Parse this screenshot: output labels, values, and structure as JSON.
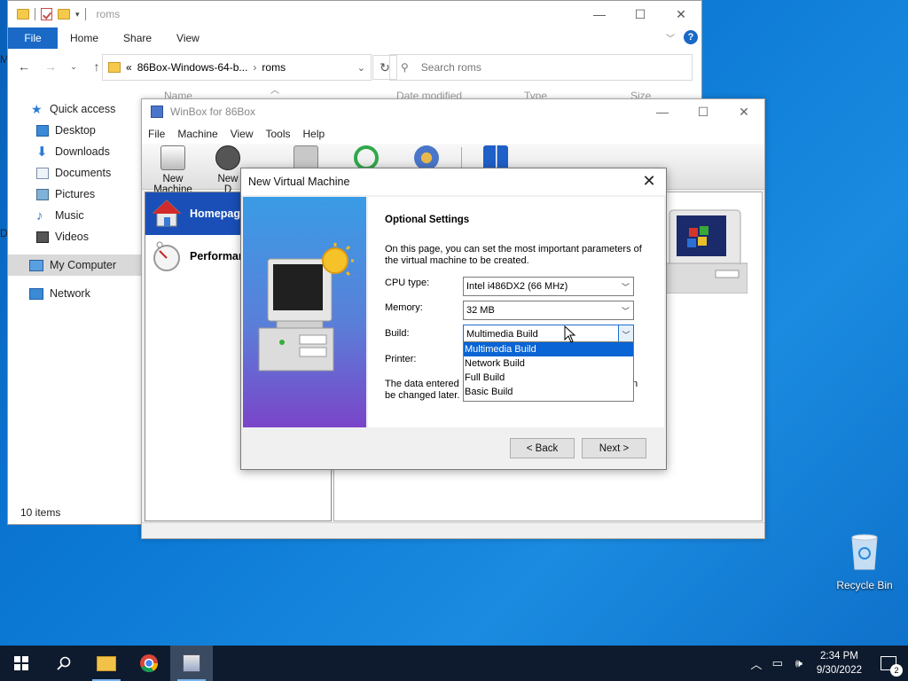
{
  "explorer": {
    "title": "roms",
    "ribbon_tabs": [
      "File",
      "Home",
      "Share",
      "View"
    ],
    "address": {
      "prefix": "«",
      "crumbs": [
        "86Box-Windows-64-b...",
        "roms"
      ]
    },
    "search_placeholder": "Search roms",
    "columns": [
      "Name",
      "Date modified",
      "Type",
      "Size"
    ],
    "nav": [
      {
        "label": "Quick access",
        "icon": "star-icon"
      },
      {
        "label": "Desktop",
        "icon": "desktop-icon"
      },
      {
        "label": "Downloads",
        "icon": "download-icon"
      },
      {
        "label": "Documents",
        "icon": "documents-icon"
      },
      {
        "label": "Pictures",
        "icon": "pictures-icon"
      },
      {
        "label": "Music",
        "icon": "music-icon"
      },
      {
        "label": "Videos",
        "icon": "videos-icon"
      },
      {
        "label": "My Computer",
        "icon": "computer-icon"
      },
      {
        "label": "Network",
        "icon": "network-icon"
      }
    ],
    "status": "10 items"
  },
  "winbox": {
    "title": "WinBox for 86Box",
    "menu": [
      "File",
      "Machine",
      "View",
      "Tools",
      "Help"
    ],
    "tools": [
      {
        "label": "New Machine"
      },
      {
        "label": "New D"
      }
    ],
    "list": [
      {
        "label": "Homepage",
        "selected": true
      },
      {
        "label": "Performan",
        "selected": false
      }
    ]
  },
  "dialog": {
    "title": "New Virtual Machine",
    "heading": "Optional Settings",
    "description": "On this page, you can set the most important parameters of the virtual machine to be created.",
    "fields": {
      "cpu_label": "CPU type:",
      "cpu_value": "Intel i486DX2 (66 MHz)",
      "memory_label": "Memory:",
      "memory_value": "32 MB",
      "build_label": "Build:",
      "build_value": "Multimedia Build",
      "printer_label": "Printer:"
    },
    "build_options": [
      "Multimedia Build",
      "Network Build",
      "Full Build",
      "Basic Build"
    ],
    "note_start": "The data entered",
    "note_mid": "n",
    "note_end": "be changed later.",
    "back_label": "< Back",
    "next_label": "Next >"
  },
  "desktop": {
    "recycle_bin": "Recycle Bin"
  },
  "taskbar": {
    "time": "2:34 PM",
    "date": "9/30/2022",
    "notification_count": "2"
  },
  "colors": {
    "selection": "#0a64d4",
    "ribbon_file": "#1a69c7",
    "taskbar": "#0e1b2e"
  }
}
